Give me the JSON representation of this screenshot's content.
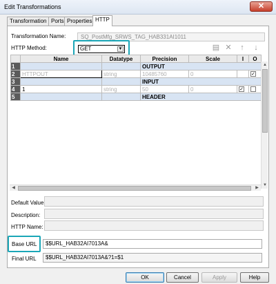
{
  "window": {
    "title": "Edit Transformations",
    "close_glyph": "✕"
  },
  "tabs": [
    "Transformation",
    "Ports",
    "Properties",
    "HTTP"
  ],
  "transformation_name": {
    "label": "Transformation Name:",
    "value": "SQ_PostMfg_SRWS_TAG_HAB331AI1011"
  },
  "http_method": {
    "label": "HTTP Method:",
    "selected": "GET"
  },
  "toolbar_icons": [
    "new-port-icon",
    "delete-icon",
    "move-up-icon",
    "move-down-icon"
  ],
  "grid": {
    "columns": [
      "",
      "Name",
      "Datatype",
      "Precision",
      "Scale",
      "I",
      "O"
    ],
    "rows": [
      {
        "num": "1",
        "section": "OUTPUT"
      },
      {
        "num": "2",
        "name": "HTTPOUT",
        "datatype": "string",
        "precision": "10485760",
        "scale": "0",
        "input": false,
        "output": true,
        "dim": true
      },
      {
        "num": "3",
        "section": "INPUT"
      },
      {
        "num": "4",
        "name": "1",
        "datatype": "string",
        "precision": "50",
        "scale": "0",
        "input": true,
        "output": false,
        "dim": false
      },
      {
        "num": "5",
        "section": "HEADER"
      }
    ]
  },
  "info": {
    "default_value_label": "Default Value:",
    "description_label": "Description:",
    "http_name_label": "HTTP Name:"
  },
  "base_url": {
    "label": "Base URL",
    "value": "$$URL_HAB32AI7013A&"
  },
  "final_url": {
    "label": "Final URL",
    "value": "$$URL_HAB32AI7013A&?1=$1"
  },
  "buttons": {
    "ok": "OK",
    "cancel": "Cancel",
    "apply": "Apply",
    "help": "Help"
  },
  "accent_colors": {
    "highlight": "#1aa6b7",
    "close": "#c7402c",
    "section_row": "#d8e4f3"
  }
}
